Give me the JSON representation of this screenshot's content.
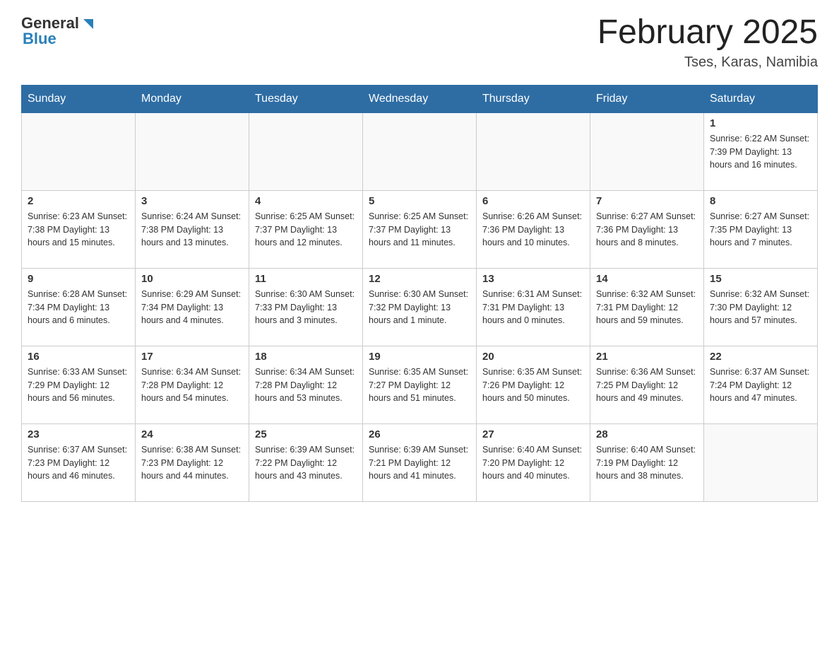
{
  "header": {
    "logo_general": "General",
    "logo_blue": "Blue",
    "title": "February 2025",
    "location": "Tses, Karas, Namibia"
  },
  "days_of_week": [
    "Sunday",
    "Monday",
    "Tuesday",
    "Wednesday",
    "Thursday",
    "Friday",
    "Saturday"
  ],
  "weeks": [
    [
      {
        "day": "",
        "info": ""
      },
      {
        "day": "",
        "info": ""
      },
      {
        "day": "",
        "info": ""
      },
      {
        "day": "",
        "info": ""
      },
      {
        "day": "",
        "info": ""
      },
      {
        "day": "",
        "info": ""
      },
      {
        "day": "1",
        "info": "Sunrise: 6:22 AM\nSunset: 7:39 PM\nDaylight: 13 hours and 16 minutes."
      }
    ],
    [
      {
        "day": "2",
        "info": "Sunrise: 6:23 AM\nSunset: 7:38 PM\nDaylight: 13 hours and 15 minutes."
      },
      {
        "day": "3",
        "info": "Sunrise: 6:24 AM\nSunset: 7:38 PM\nDaylight: 13 hours and 13 minutes."
      },
      {
        "day": "4",
        "info": "Sunrise: 6:25 AM\nSunset: 7:37 PM\nDaylight: 13 hours and 12 minutes."
      },
      {
        "day": "5",
        "info": "Sunrise: 6:25 AM\nSunset: 7:37 PM\nDaylight: 13 hours and 11 minutes."
      },
      {
        "day": "6",
        "info": "Sunrise: 6:26 AM\nSunset: 7:36 PM\nDaylight: 13 hours and 10 minutes."
      },
      {
        "day": "7",
        "info": "Sunrise: 6:27 AM\nSunset: 7:36 PM\nDaylight: 13 hours and 8 minutes."
      },
      {
        "day": "8",
        "info": "Sunrise: 6:27 AM\nSunset: 7:35 PM\nDaylight: 13 hours and 7 minutes."
      }
    ],
    [
      {
        "day": "9",
        "info": "Sunrise: 6:28 AM\nSunset: 7:34 PM\nDaylight: 13 hours and 6 minutes."
      },
      {
        "day": "10",
        "info": "Sunrise: 6:29 AM\nSunset: 7:34 PM\nDaylight: 13 hours and 4 minutes."
      },
      {
        "day": "11",
        "info": "Sunrise: 6:30 AM\nSunset: 7:33 PM\nDaylight: 13 hours and 3 minutes."
      },
      {
        "day": "12",
        "info": "Sunrise: 6:30 AM\nSunset: 7:32 PM\nDaylight: 13 hours and 1 minute."
      },
      {
        "day": "13",
        "info": "Sunrise: 6:31 AM\nSunset: 7:31 PM\nDaylight: 13 hours and 0 minutes."
      },
      {
        "day": "14",
        "info": "Sunrise: 6:32 AM\nSunset: 7:31 PM\nDaylight: 12 hours and 59 minutes."
      },
      {
        "day": "15",
        "info": "Sunrise: 6:32 AM\nSunset: 7:30 PM\nDaylight: 12 hours and 57 minutes."
      }
    ],
    [
      {
        "day": "16",
        "info": "Sunrise: 6:33 AM\nSunset: 7:29 PM\nDaylight: 12 hours and 56 minutes."
      },
      {
        "day": "17",
        "info": "Sunrise: 6:34 AM\nSunset: 7:28 PM\nDaylight: 12 hours and 54 minutes."
      },
      {
        "day": "18",
        "info": "Sunrise: 6:34 AM\nSunset: 7:28 PM\nDaylight: 12 hours and 53 minutes."
      },
      {
        "day": "19",
        "info": "Sunrise: 6:35 AM\nSunset: 7:27 PM\nDaylight: 12 hours and 51 minutes."
      },
      {
        "day": "20",
        "info": "Sunrise: 6:35 AM\nSunset: 7:26 PM\nDaylight: 12 hours and 50 minutes."
      },
      {
        "day": "21",
        "info": "Sunrise: 6:36 AM\nSunset: 7:25 PM\nDaylight: 12 hours and 49 minutes."
      },
      {
        "day": "22",
        "info": "Sunrise: 6:37 AM\nSunset: 7:24 PM\nDaylight: 12 hours and 47 minutes."
      }
    ],
    [
      {
        "day": "23",
        "info": "Sunrise: 6:37 AM\nSunset: 7:23 PM\nDaylight: 12 hours and 46 minutes."
      },
      {
        "day": "24",
        "info": "Sunrise: 6:38 AM\nSunset: 7:23 PM\nDaylight: 12 hours and 44 minutes."
      },
      {
        "day": "25",
        "info": "Sunrise: 6:39 AM\nSunset: 7:22 PM\nDaylight: 12 hours and 43 minutes."
      },
      {
        "day": "26",
        "info": "Sunrise: 6:39 AM\nSunset: 7:21 PM\nDaylight: 12 hours and 41 minutes."
      },
      {
        "day": "27",
        "info": "Sunrise: 6:40 AM\nSunset: 7:20 PM\nDaylight: 12 hours and 40 minutes."
      },
      {
        "day": "28",
        "info": "Sunrise: 6:40 AM\nSunset: 7:19 PM\nDaylight: 12 hours and 38 minutes."
      },
      {
        "day": "",
        "info": ""
      }
    ]
  ]
}
